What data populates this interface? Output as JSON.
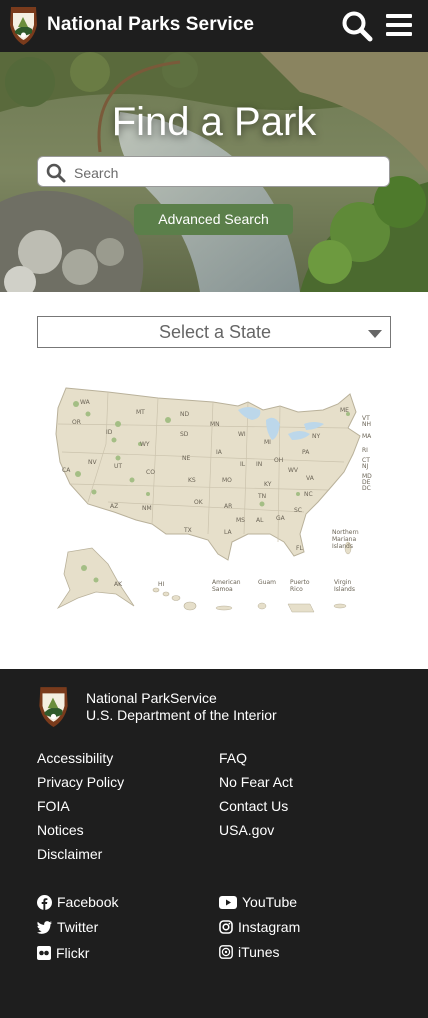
{
  "header": {
    "brand": "National Parks Service",
    "logo_icon": "nps-arrowhead-logo-icon",
    "search_icon": "search-icon",
    "menu_icon": "hamburger-menu-icon",
    "bg_color": "#1e1e1e"
  },
  "hero": {
    "title": "Find a Park",
    "search_placeholder": "Search",
    "advanced_search_label": "Advanced Search",
    "button_color": "#5b7f4a"
  },
  "state_select": {
    "label": "Select a State"
  },
  "map": {
    "state_labels": [
      "WA",
      "MT",
      "ND",
      "OR",
      "ID",
      "SD",
      "MN",
      "WI",
      "MI",
      "NY",
      "ME",
      "VT",
      "NH",
      "MA",
      "RI",
      "CT",
      "NJ",
      "MD",
      "DE",
      "DC",
      "WY",
      "NE",
      "IA",
      "PA",
      "NV",
      "UT",
      "CO",
      "IL",
      "IN",
      "OH",
      "CA",
      "KS",
      "MO",
      "WV",
      "VA",
      "KY",
      "OK",
      "TN",
      "NC",
      "AZ",
      "NM",
      "AR",
      "SC",
      "MS",
      "AL",
      "GA",
      "TX",
      "LA",
      "FL",
      "AK",
      "HI"
    ],
    "territories": [
      "American Samoa",
      "Guam",
      "Puerto Rico",
      "Virgin Islands",
      "Northern Mariana Islands"
    ]
  },
  "footer": {
    "org_line1": "National ParkService",
    "org_line2": "U.S. Department of the Interior",
    "links_left": [
      "Accessibility",
      "Privacy Policy",
      "FOIA",
      "Notices",
      "Disclaimer"
    ],
    "links_right": [
      "FAQ",
      "No Fear Act",
      "Contact Us",
      "USA.gov"
    ],
    "social_left": [
      {
        "label": "Facebook",
        "icon": "facebook-icon"
      },
      {
        "label": "Twitter",
        "icon": "twitter-icon"
      },
      {
        "label": "Flickr",
        "icon": "flickr-icon"
      }
    ],
    "social_right": [
      {
        "label": "YouTube",
        "icon": "youtube-icon"
      },
      {
        "label": "Instagram",
        "icon": "instagram-icon"
      },
      {
        "label": "iTunes",
        "icon": "itunes-icon"
      }
    ]
  }
}
